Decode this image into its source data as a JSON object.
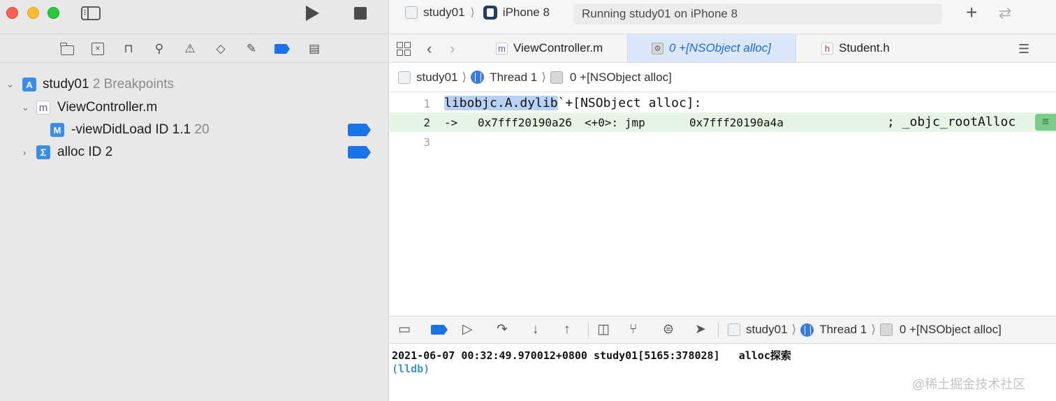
{
  "toolbar": {
    "scheme_name": "study01",
    "device_name": "iPhone 8",
    "status_text": "Running study01 on iPhone 8"
  },
  "breakpoint_navigator": {
    "project": {
      "name": "study01",
      "detail": "2 Breakpoints"
    },
    "file": {
      "name": "ViewController.m"
    },
    "method_bp": {
      "label": "-viewDidLoad",
      "id": "ID 1.1",
      "line": "20"
    },
    "symbol_bp": {
      "label": "alloc ID 2"
    }
  },
  "editor_tabs": [
    {
      "label": "ViewController.m",
      "icon": "m-file-icon"
    },
    {
      "label": "0 +[NSObject alloc]",
      "icon": "gear-icon",
      "active": true
    },
    {
      "label": "Student.h",
      "icon": "h-file-icon"
    }
  ],
  "jump_bar": {
    "project": "study01",
    "thread": "Thread 1",
    "frame": "0 +[NSObject alloc]"
  },
  "code": {
    "lines": [
      {
        "number": "1",
        "highlight": "libobjc.A.dylib",
        "rest": "`+[NSObject alloc]:"
      },
      {
        "number": "2",
        "arrow": "->",
        "address": "0x7fff20190a26",
        "offset": "<+0>: jmp",
        "target": "0x7fff20190a4a",
        "comment": "; _objc_rootAlloc"
      },
      {
        "number": "3"
      }
    ],
    "pc_badge": "≡"
  },
  "debug_bar": {
    "project": "study01",
    "thread": "Thread 1",
    "frame": "0 +[NSObject alloc]"
  },
  "console": {
    "log": "2021-06-07 00:32:49.970012+0800 study01[5165:378028]   alloc探索",
    "prompt": "(lldb)"
  },
  "watermark": "@稀土掘金技术社区",
  "colors": {
    "accent": "#1a73e8",
    "current_line": "#e6f4e6",
    "selection": "#b8d2f5",
    "prompt": "#3f98b8"
  }
}
